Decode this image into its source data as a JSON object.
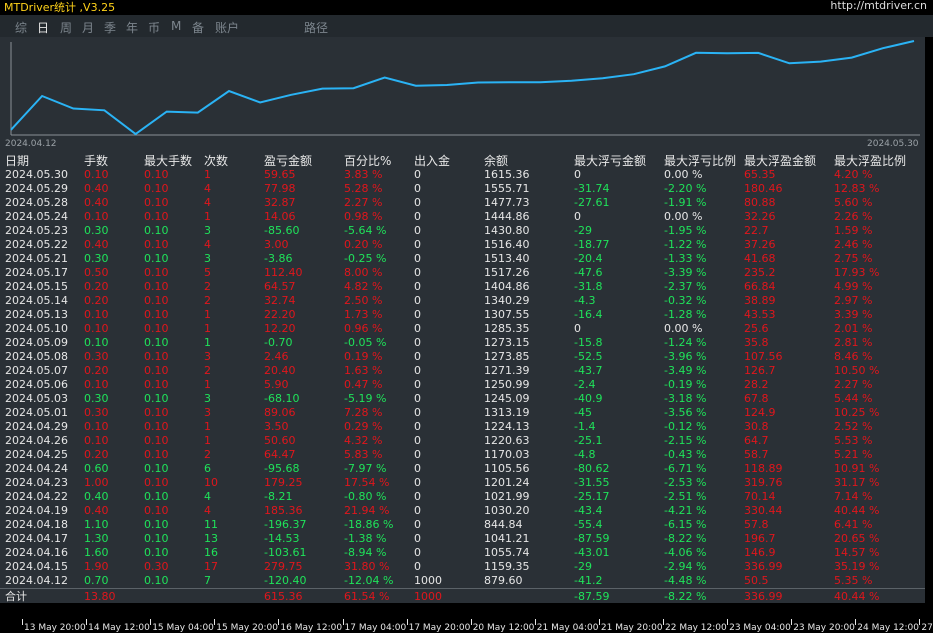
{
  "app": {
    "title": "MTDriver统计 ,V3.25",
    "url": "http://mtdriver.cn"
  },
  "tabs": [
    "综",
    "日",
    "周",
    "月",
    "季",
    "年",
    "币",
    "M",
    "备",
    "账户",
    "路径"
  ],
  "active_tab": "日",
  "chart": {
    "start_label": "2024.04.12",
    "end_label": "2024.05.30",
    "line_color": "#2ab3f5"
  },
  "columns": [
    "日期",
    "手数",
    "最大手数",
    "次数",
    "盈亏金额",
    "百分比%",
    "出入金",
    "余额",
    "最大浮亏金额",
    "最大浮亏比例",
    "最大浮盈金额",
    "最大浮盈比例"
  ],
  "rows": [
    [
      "2024.05.30",
      "0.10",
      "0.10",
      "1",
      "59.65",
      "3.83 %",
      "0",
      "1615.36",
      "0",
      "0.00 %",
      "65.35",
      "4.20 %"
    ],
    [
      "2024.05.29",
      "0.40",
      "0.10",
      "4",
      "77.98",
      "5.28 %",
      "0",
      "1555.71",
      "-31.74",
      "-2.20 %",
      "180.46",
      "12.83 %"
    ],
    [
      "2024.05.28",
      "0.40",
      "0.10",
      "4",
      "32.87",
      "2.27 %",
      "0",
      "1477.73",
      "-27.61",
      "-1.91 %",
      "80.88",
      "5.60 %"
    ],
    [
      "2024.05.24",
      "0.10",
      "0.10",
      "1",
      "14.06",
      "0.98 %",
      "0",
      "1444.86",
      "0",
      "0.00 %",
      "32.26",
      "2.26 %"
    ],
    [
      "2024.05.23",
      "0.30",
      "0.10",
      "3",
      "-85.60",
      "-5.64 %",
      "0",
      "1430.80",
      "-29",
      "-1.95 %",
      "22.7",
      "1.59 %"
    ],
    [
      "2024.05.22",
      "0.40",
      "0.10",
      "4",
      "3.00",
      "0.20 %",
      "0",
      "1516.40",
      "-18.77",
      "-1.22 %",
      "37.26",
      "2.46 %"
    ],
    [
      "2024.05.21",
      "0.30",
      "0.10",
      "3",
      "-3.86",
      "-0.25 %",
      "0",
      "1513.40",
      "-20.4",
      "-1.33 %",
      "41.68",
      "2.75 %"
    ],
    [
      "2024.05.17",
      "0.50",
      "0.10",
      "5",
      "112.40",
      "8.00 %",
      "0",
      "1517.26",
      "-47.6",
      "-3.39 %",
      "235.2",
      "17.93 %"
    ],
    [
      "2024.05.15",
      "0.20",
      "0.10",
      "2",
      "64.57",
      "4.82 %",
      "0",
      "1404.86",
      "-31.8",
      "-2.37 %",
      "66.84",
      "4.99 %"
    ],
    [
      "2024.05.14",
      "0.20",
      "0.10",
      "2",
      "32.74",
      "2.50 %",
      "0",
      "1340.29",
      "-4.3",
      "-0.32 %",
      "38.89",
      "2.97 %"
    ],
    [
      "2024.05.13",
      "0.10",
      "0.10",
      "1",
      "22.20",
      "1.73 %",
      "0",
      "1307.55",
      "-16.4",
      "-1.28 %",
      "43.53",
      "3.39 %"
    ],
    [
      "2024.05.10",
      "0.10",
      "0.10",
      "1",
      "12.20",
      "0.96 %",
      "0",
      "1285.35",
      "0",
      "0.00 %",
      "25.6",
      "2.01 %"
    ],
    [
      "2024.05.09",
      "0.10",
      "0.10",
      "1",
      "-0.70",
      "-0.05 %",
      "0",
      "1273.15",
      "-15.8",
      "-1.24 %",
      "35.8",
      "2.81 %"
    ],
    [
      "2024.05.08",
      "0.30",
      "0.10",
      "3",
      "2.46",
      "0.19 %",
      "0",
      "1273.85",
      "-52.5",
      "-3.96 %",
      "107.56",
      "8.46 %"
    ],
    [
      "2024.05.07",
      "0.20",
      "0.10",
      "2",
      "20.40",
      "1.63 %",
      "0",
      "1271.39",
      "-43.7",
      "-3.49 %",
      "126.7",
      "10.50 %"
    ],
    [
      "2024.05.06",
      "0.10",
      "0.10",
      "1",
      "5.90",
      "0.47 %",
      "0",
      "1250.99",
      "-2.4",
      "-0.19 %",
      "28.2",
      "2.27 %"
    ],
    [
      "2024.05.03",
      "0.30",
      "0.10",
      "3",
      "-68.10",
      "-5.19 %",
      "0",
      "1245.09",
      "-40.9",
      "-3.18 %",
      "67.8",
      "5.44 %"
    ],
    [
      "2024.05.01",
      "0.30",
      "0.10",
      "3",
      "89.06",
      "7.28 %",
      "0",
      "1313.19",
      "-45",
      "-3.56 %",
      "124.9",
      "10.25 %"
    ],
    [
      "2024.04.29",
      "0.10",
      "0.10",
      "1",
      "3.50",
      "0.29 %",
      "0",
      "1224.13",
      "-1.4",
      "-0.12 %",
      "30.8",
      "2.52 %"
    ],
    [
      "2024.04.26",
      "0.10",
      "0.10",
      "1",
      "50.60",
      "4.32 %",
      "0",
      "1220.63",
      "-25.1",
      "-2.15 %",
      "64.7",
      "5.53 %"
    ],
    [
      "2024.04.25",
      "0.20",
      "0.10",
      "2",
      "64.47",
      "5.83 %",
      "0",
      "1170.03",
      "-4.8",
      "-0.43 %",
      "58.7",
      "5.21 %"
    ],
    [
      "2024.04.24",
      "0.60",
      "0.10",
      "6",
      "-95.68",
      "-7.97 %",
      "0",
      "1105.56",
      "-80.62",
      "-6.71 %",
      "118.89",
      "10.91 %"
    ],
    [
      "2024.04.23",
      "1.00",
      "0.10",
      "10",
      "179.25",
      "17.54 %",
      "0",
      "1201.24",
      "-31.55",
      "-2.53 %",
      "319.76",
      "31.17 %"
    ],
    [
      "2024.04.22",
      "0.40",
      "0.10",
      "4",
      "-8.21",
      "-0.80 %",
      "0",
      "1021.99",
      "-25.17",
      "-2.51 %",
      "70.14",
      "7.14 %"
    ],
    [
      "2024.04.19",
      "0.40",
      "0.10",
      "4",
      "185.36",
      "21.94 %",
      "0",
      "1030.20",
      "-43.4",
      "-4.21 %",
      "330.44",
      "40.44 %"
    ],
    [
      "2024.04.18",
      "1.10",
      "0.10",
      "11",
      "-196.37",
      "-18.86 %",
      "0",
      "844.84",
      "-55.4",
      "-6.15 %",
      "57.8",
      "6.41 %"
    ],
    [
      "2024.04.17",
      "1.30",
      "0.10",
      "13",
      "-14.53",
      "-1.38 %",
      "0",
      "1041.21",
      "-87.59",
      "-8.22 %",
      "196.7",
      "20.65 %"
    ],
    [
      "2024.04.16",
      "1.60",
      "0.10",
      "16",
      "-103.61",
      "-8.94 %",
      "0",
      "1055.74",
      "-43.01",
      "-4.06 %",
      "146.9",
      "14.57 %"
    ],
    [
      "2024.04.15",
      "1.90",
      "0.30",
      "17",
      "279.75",
      "31.80 %",
      "0",
      "1159.35",
      "-29",
      "-2.94 %",
      "336.99",
      "35.19 %"
    ],
    [
      "2024.04.12",
      "0.70",
      "0.10",
      "7",
      "-120.40",
      "-12.04 %",
      "1000",
      "879.60",
      "-41.2",
      "-4.48 %",
      "50.5",
      "5.35 %"
    ]
  ],
  "total": [
    "合计",
    "13.80",
    "",
    "",
    "615.36",
    "61.54 %",
    "1000",
    "",
    "-87.59",
    "-8.22 %",
    "336.99",
    "40.44 %"
  ],
  "bottom_axis": [
    "13 May 20:00",
    "14 May 12:00",
    "15 May 04:00",
    "15 May 20:00",
    "16 May 12:00",
    "17 May 04:00",
    "17 May 20:00",
    "20 May 12:00",
    "21 May 04:00",
    "21 May 20:00",
    "22 May 12:00",
    "23 May 04:00",
    "23 May 20:00",
    "24 May 12:00",
    "27"
  ]
}
